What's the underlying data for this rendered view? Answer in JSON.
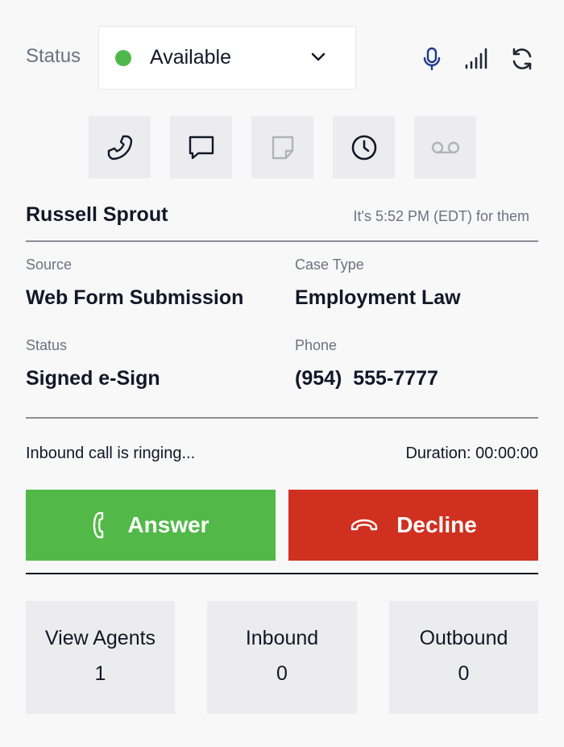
{
  "status": {
    "label": "Status",
    "selected": "Available",
    "dot_color": "#4fb84a"
  },
  "toolbar": {
    "icons": [
      "microphone-icon",
      "signal-strength-icon",
      "refresh-icon"
    ]
  },
  "actions": {
    "tiles": [
      {
        "name": "phone-icon",
        "enabled": true
      },
      {
        "name": "chat-icon",
        "enabled": true
      },
      {
        "name": "note-icon",
        "enabled": false
      },
      {
        "name": "clock-icon",
        "enabled": true
      },
      {
        "name": "voicemail-icon",
        "enabled": false
      }
    ]
  },
  "contact": {
    "name": "Russell Sprout",
    "local_time": "It's 5:52 PM (EDT) for them",
    "source_label": "Source",
    "source": "Web Form Submission",
    "case_type_label": "Case Type",
    "case_type": "Employment Law",
    "status_label": "Status",
    "status": "Signed e-Sign",
    "phone_label": "Phone",
    "phone": "(954)  555-7777"
  },
  "call": {
    "state_text": "Inbound call is ringing...",
    "duration": "Duration: 00:00:00",
    "answer_label": "Answer",
    "decline_label": "Decline",
    "answer_color": "#52b948",
    "decline_color": "#d0301f"
  },
  "stats": [
    {
      "label": "View Agents",
      "count": "1"
    },
    {
      "label": "Inbound",
      "count": "0"
    },
    {
      "label": "Outbound",
      "count": "0"
    }
  ]
}
